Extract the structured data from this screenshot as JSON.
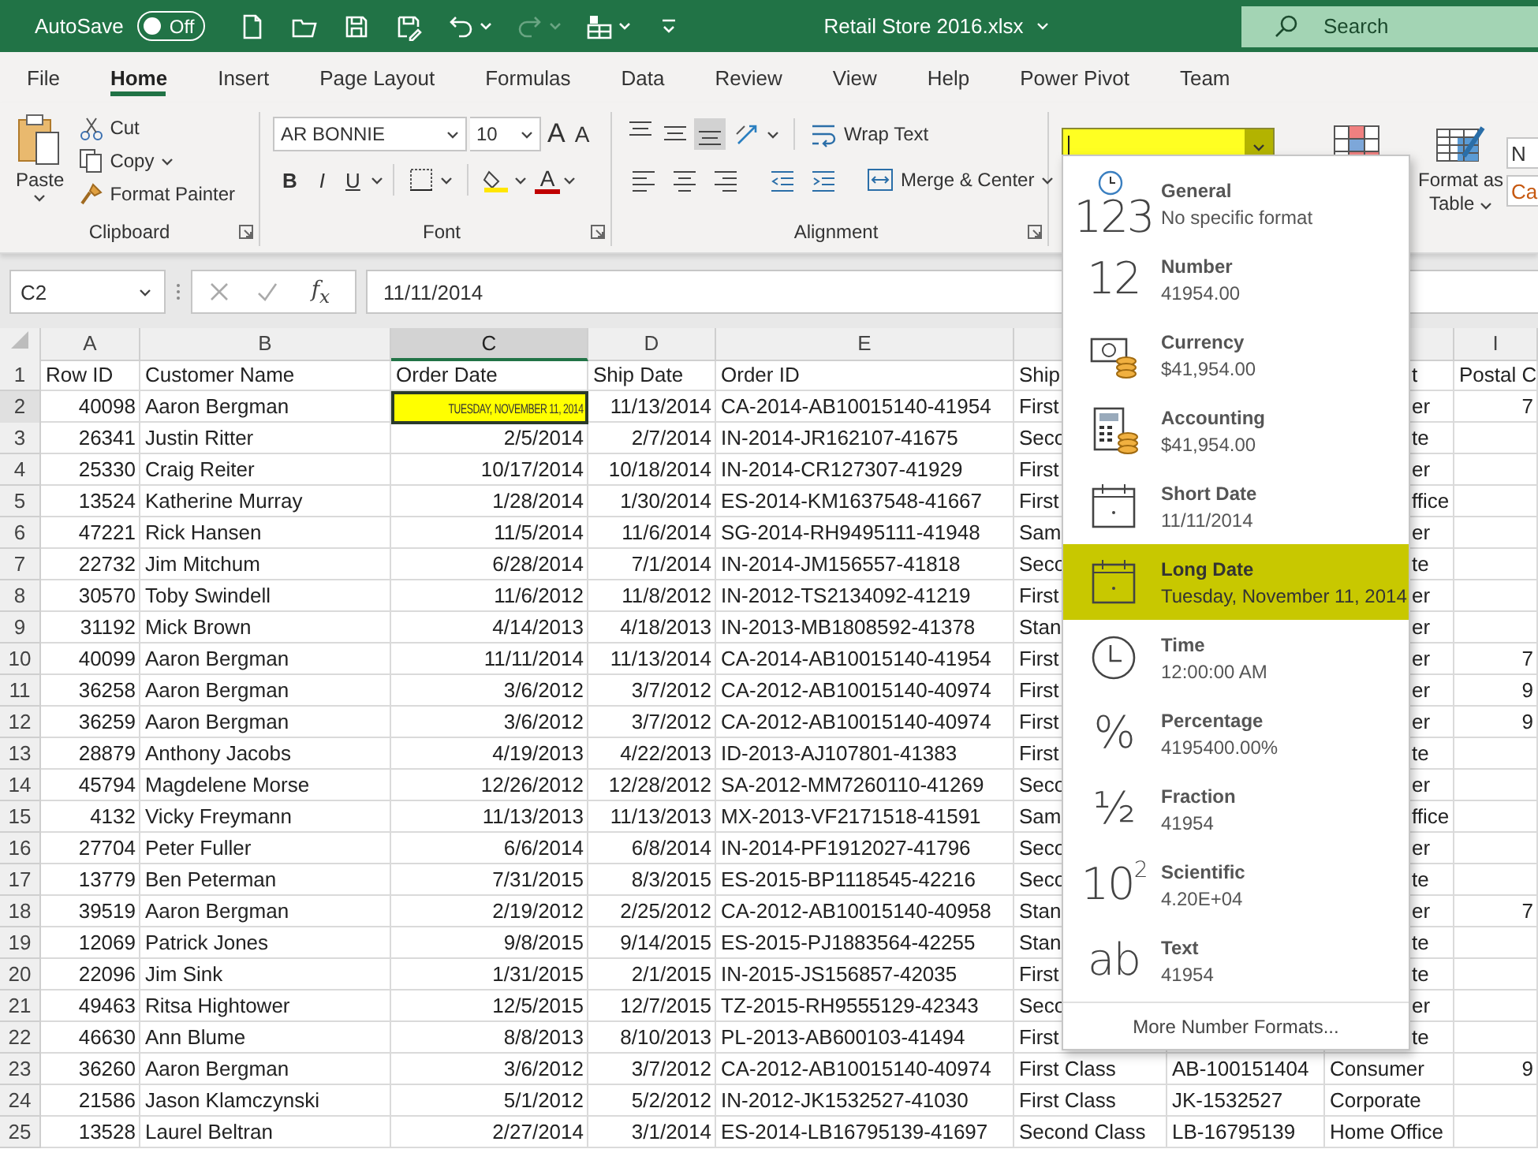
{
  "title_bar": {
    "autosave": {
      "label": "AutoSave",
      "on": false,
      "state_text": "Off"
    },
    "quick_access": [
      {
        "kind": "new",
        "disabled": false
      },
      {
        "kind": "open",
        "disabled": false
      },
      {
        "kind": "save",
        "disabled": false
      },
      {
        "kind": "save_as",
        "disabled": false
      },
      {
        "kind": "undo",
        "disabled": false
      },
      {
        "kind": "redo",
        "disabled": true
      },
      {
        "kind": "form",
        "disabled": false
      },
      {
        "kind": "customize",
        "disabled": false
      }
    ],
    "title": "Retail Store 2016.xlsx",
    "search": {
      "placeholder": "Search"
    }
  },
  "tabs": [
    {
      "label": "File",
      "selected": false
    },
    {
      "label": "Home",
      "selected": true
    },
    {
      "label": "Insert",
      "selected": false
    },
    {
      "label": "Page Layout",
      "selected": false
    },
    {
      "label": "Formulas",
      "selected": false
    },
    {
      "label": "Data",
      "selected": false
    },
    {
      "label": "Review",
      "selected": false
    },
    {
      "label": "View",
      "selected": false
    },
    {
      "label": "Help",
      "selected": false
    },
    {
      "label": "Power Pivot",
      "selected": false
    },
    {
      "label": "Team",
      "selected": false
    }
  ],
  "ribbon": {
    "clipboard": {
      "paste": "Paste",
      "cut": "Cut",
      "copy": "Copy",
      "format_painter": "Format Painter",
      "label": "Clipboard"
    },
    "font": {
      "name": "AR BONNIE",
      "size": "10",
      "grow": "A",
      "shrink": "A",
      "bold": "B",
      "italic": "I",
      "underline": "U",
      "font_color": "A",
      "label": "Font"
    },
    "alignment": {
      "vertical": [
        {
          "kind": "top",
          "selected": false
        },
        {
          "kind": "middle",
          "selected": false
        },
        {
          "kind": "bottom",
          "selected": true
        }
      ],
      "wrap_text": "Wrap Text",
      "merge_center": "Merge & Center",
      "label": "Alignment"
    },
    "number_format": {
      "open": true
    },
    "format_as_table": "Format as Table",
    "cell_styles": [
      "N",
      "Ca"
    ]
  },
  "formula_bar": {
    "name_box": "C2",
    "function_symbol": "f$_{x}$",
    "value": "11/11/2014"
  },
  "column_headers": [
    {
      "label": "A",
      "selected": false
    },
    {
      "label": "B",
      "selected": false
    },
    {
      "label": "C",
      "selected": true
    },
    {
      "label": "D",
      "selected": false
    },
    {
      "label": "E",
      "selected": false
    },
    {
      "label": "I",
      "selected": false
    }
  ],
  "rows": [
    {
      "number": "1",
      "kind": "header",
      "selected": false,
      "cells": {
        "a": "Row ID",
        "b": "Customer Name",
        "c": "Order Date",
        "d": "Ship Date",
        "e": "Order ID",
        "f": "Ship",
        "h": "t",
        "i": "Postal C"
      }
    },
    {
      "number": "2",
      "kind": "data",
      "selected": true,
      "cells": {
        "a": "40098",
        "b": "Aaron Bergman",
        "c": "TUESDAY, NOVEMBER 11, 2014",
        "d": "11/13/2014",
        "e": "CA-2014-AB10015140-41954",
        "f": "First",
        "h": "er",
        "i": "7"
      }
    },
    {
      "number": "3",
      "kind": "data",
      "selected": false,
      "cells": {
        "a": "26341",
        "b": "Justin Ritter",
        "c": "2/5/2014",
        "d": "2/7/2014",
        "e": "IN-2014-JR162107-41675",
        "f": "Seco",
        "h": "te"
      }
    },
    {
      "number": "4",
      "kind": "data",
      "selected": false,
      "cells": {
        "a": "25330",
        "b": "Craig Reiter",
        "c": "10/17/2014",
        "d": "10/18/2014",
        "e": "IN-2014-CR127307-41929",
        "f": "First",
        "h": "er"
      }
    },
    {
      "number": "5",
      "kind": "data",
      "selected": false,
      "cells": {
        "a": "13524",
        "b": "Katherine Murray",
        "c": "1/28/2014",
        "d": "1/30/2014",
        "e": "ES-2014-KM1637548-41667",
        "f": "First",
        "h": "ffice"
      }
    },
    {
      "number": "6",
      "kind": "data",
      "selected": false,
      "cells": {
        "a": "47221",
        "b": "Rick Hansen",
        "c": "11/5/2014",
        "d": "11/6/2014",
        "e": "SG-2014-RH9495111-41948",
        "f": "Sam",
        "h": "er"
      }
    },
    {
      "number": "7",
      "kind": "data",
      "selected": false,
      "cells": {
        "a": "22732",
        "b": "Jim Mitchum",
        "c": "6/28/2014",
        "d": "7/1/2014",
        "e": "IN-2014-JM156557-41818",
        "f": "Seco",
        "h": "te"
      }
    },
    {
      "number": "8",
      "kind": "data",
      "selected": false,
      "cells": {
        "a": "30570",
        "b": "Toby Swindell",
        "c": "11/6/2012",
        "d": "11/8/2012",
        "e": "IN-2012-TS2134092-41219",
        "f": "First",
        "h": "er"
      }
    },
    {
      "number": "9",
      "kind": "data",
      "selected": false,
      "cells": {
        "a": "31192",
        "b": "Mick Brown",
        "c": "4/14/2013",
        "d": "4/18/2013",
        "e": "IN-2013-MB1808592-41378",
        "f": "Stan",
        "h": "er"
      }
    },
    {
      "number": "10",
      "kind": "data",
      "selected": false,
      "cells": {
        "a": "40099",
        "b": "Aaron Bergman",
        "c": "11/11/2014",
        "d": "11/13/2014",
        "e": "CA-2014-AB10015140-41954",
        "f": "First",
        "h": "er",
        "i": "7"
      }
    },
    {
      "number": "11",
      "kind": "data",
      "selected": false,
      "cells": {
        "a": "36258",
        "b": "Aaron Bergman",
        "c": "3/6/2012",
        "d": "3/7/2012",
        "e": "CA-2012-AB10015140-40974",
        "f": "First",
        "h": "er",
        "i": "9"
      }
    },
    {
      "number": "12",
      "kind": "data",
      "selected": false,
      "cells": {
        "a": "36259",
        "b": "Aaron Bergman",
        "c": "3/6/2012",
        "d": "3/7/2012",
        "e": "CA-2012-AB10015140-40974",
        "f": "First",
        "h": "er",
        "i": "9"
      }
    },
    {
      "number": "13",
      "kind": "data",
      "selected": false,
      "cells": {
        "a": "28879",
        "b": "Anthony Jacobs",
        "c": "4/19/2013",
        "d": "4/22/2013",
        "e": "ID-2013-AJ107801-41383",
        "f": "First",
        "h": "te"
      }
    },
    {
      "number": "14",
      "kind": "data",
      "selected": false,
      "cells": {
        "a": "45794",
        "b": "Magdelene Morse",
        "c": "12/26/2012",
        "d": "12/28/2012",
        "e": "SA-2012-MM7260110-41269",
        "f": "Seco",
        "h": "er"
      }
    },
    {
      "number": "15",
      "kind": "data",
      "selected": false,
      "cells": {
        "a": "4132",
        "b": "Vicky Freymann",
        "c": "11/13/2013",
        "d": "11/13/2013",
        "e": "MX-2013-VF2171518-41591",
        "f": "Sam",
        "h": "ffice"
      }
    },
    {
      "number": "16",
      "kind": "data",
      "selected": false,
      "cells": {
        "a": "27704",
        "b": "Peter Fuller",
        "c": "6/6/2014",
        "d": "6/8/2014",
        "e": "IN-2014-PF1912027-41796",
        "f": "Seco",
        "h": "er"
      }
    },
    {
      "number": "17",
      "kind": "data",
      "selected": false,
      "cells": {
        "a": "13779",
        "b": "Ben Peterman",
        "c": "7/31/2015",
        "d": "8/3/2015",
        "e": "ES-2015-BP1118545-42216",
        "f": "Seco",
        "h": "te"
      }
    },
    {
      "number": "18",
      "kind": "data",
      "selected": false,
      "cells": {
        "a": "39519",
        "b": "Aaron Bergman",
        "c": "2/19/2012",
        "d": "2/25/2012",
        "e": "CA-2012-AB10015140-40958",
        "f": "Stan",
        "h": "er",
        "i": "7"
      }
    },
    {
      "number": "19",
      "kind": "data",
      "selected": false,
      "cells": {
        "a": "12069",
        "b": "Patrick Jones",
        "c": "9/8/2015",
        "d": "9/14/2015",
        "e": "ES-2015-PJ1883564-42255",
        "f": "Stan",
        "h": "te"
      }
    },
    {
      "number": "20",
      "kind": "data",
      "selected": false,
      "cells": {
        "a": "22096",
        "b": "Jim Sink",
        "c": "1/31/2015",
        "d": "2/1/2015",
        "e": "IN-2015-JS156857-42035",
        "f": "First",
        "h": "te"
      }
    },
    {
      "number": "21",
      "kind": "data",
      "selected": false,
      "cells": {
        "a": "49463",
        "b": "Ritsa Hightower",
        "c": "12/5/2015",
        "d": "12/7/2015",
        "e": "TZ-2015-RH9555129-42343",
        "f": "Seco",
        "h": "er"
      }
    },
    {
      "number": "22",
      "kind": "data",
      "selected": false,
      "cells": {
        "a": "46630",
        "b": "Ann Blume",
        "c": "8/8/2013",
        "d": "8/10/2013",
        "e": "PL-2013-AB600103-41494",
        "f": "First",
        "h": "te"
      }
    },
    {
      "number": "23",
      "kind": "data",
      "selected": false,
      "cells": {
        "a": "36260",
        "b": "Aaron Bergman",
        "c": "3/6/2012",
        "d": "3/7/2012",
        "e": "CA-2012-AB10015140-40974",
        "f": "First Class",
        "g": "AB-100151404",
        "h": "Consumer",
        "i": "9"
      }
    },
    {
      "number": "24",
      "kind": "data",
      "selected": false,
      "cells": {
        "a": "21586",
        "b": "Jason Klamczynski",
        "c": "5/1/2012",
        "d": "5/2/2012",
        "e": "IN-2012-JK1532527-41030",
        "f": "First Class",
        "g": "JK-1532527",
        "h": "Corporate"
      }
    },
    {
      "number": "25",
      "kind": "data",
      "selected": false,
      "cells": {
        "a": "13528",
        "b": "Laurel Beltran",
        "c": "2/27/2014",
        "d": "3/1/2014",
        "e": "ES-2014-LB16795139-41697",
        "f": "Second Class",
        "g": "LB-16795139",
        "h": "Home Office"
      }
    }
  ],
  "number_formats": [
    {
      "kind": "general",
      "glyph": "123",
      "name": "General",
      "sample": "No specific format",
      "selected": false
    },
    {
      "kind": "number",
      "glyph": "12",
      "name": "Number",
      "sample": "41954.00",
      "selected": false
    },
    {
      "kind": "currency",
      "name": "Currency",
      "sample": "$41,954.00",
      "selected": false
    },
    {
      "kind": "accounting",
      "name": "Accounting",
      "sample": " $41,954.00",
      "selected": false
    },
    {
      "kind": "short_date",
      "name": "Short Date",
      "sample": "11/11/2014",
      "selected": false
    },
    {
      "kind": "long_date",
      "name": "Long Date",
      "sample": "Tuesday, November 11, 2014",
      "selected": true
    },
    {
      "kind": "time",
      "name": "Time",
      "sample": "12:00:00 AM",
      "selected": false
    },
    {
      "kind": "percentage",
      "glyph": "%",
      "name": "Percentage",
      "sample": "4195400.00%",
      "selected": false
    },
    {
      "kind": "fraction",
      "glyph": "½",
      "name": "Fraction",
      "sample": "41954",
      "selected": false
    },
    {
      "kind": "scientific",
      "glyph": "10$^{2}$",
      "name": "Scientific",
      "sample": "4.20E+04",
      "selected": false
    },
    {
      "kind": "text",
      "glyph": "ab",
      "name": "Text",
      "sample": "41954",
      "selected": false
    }
  ],
  "more_formats": "More Number Formats..."
}
